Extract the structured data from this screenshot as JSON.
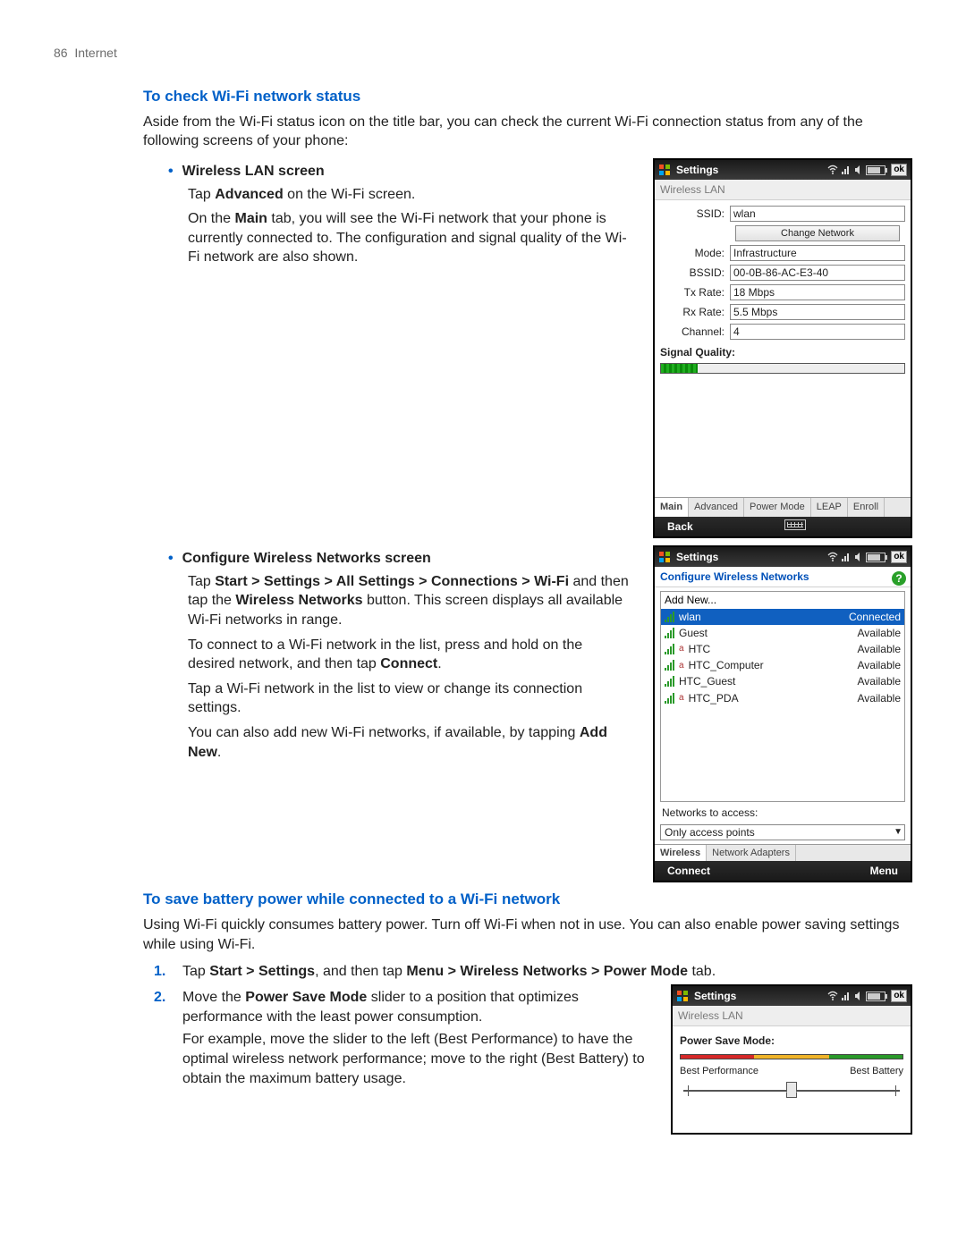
{
  "header": {
    "page_number": "86",
    "section": "Internet"
  },
  "s1": {
    "title": "To check Wi-Fi network status",
    "intro": "Aside from the Wi-Fi status icon on the title bar, you can check the current Wi-Fi connection status from any of the following screens of your phone:",
    "b1": {
      "head": "Wireless LAN screen",
      "p1a": "Tap ",
      "p1b": "Advanced",
      "p1c": " on the Wi-Fi screen.",
      "p2a": "On the ",
      "p2b": "Main",
      "p2c": " tab, you will see the Wi-Fi network that your phone is currently connected to. The configuration and signal quality of the Wi-Fi network are also shown."
    },
    "b2": {
      "head": "Configure Wireless Networks screen",
      "p1a": "Tap ",
      "p1b": "Start > Settings > All Settings > Connections > Wi-Fi",
      "p1c": " and then tap the ",
      "p1d": "Wireless Networks",
      "p1e": " button. This screen displays all available Wi-Fi networks in range.",
      "p2a": "To connect to a Wi-Fi network in the list, press and hold on the desired network, and then tap ",
      "p2b": "Connect",
      "p2c": ".",
      "p3": "Tap a Wi-Fi network in the list to view or change its connection settings.",
      "p4a": "You can also add new Wi-Fi networks, if available, by tapping ",
      "p4b": "Add New",
      "p4c": "."
    }
  },
  "s2": {
    "title": "To save battery power while connected to a Wi-Fi network",
    "intro": "Using Wi-Fi quickly consumes battery power. Turn off Wi-Fi when not in use. You can also enable power saving settings while using Wi-Fi.",
    "n1": {
      "num": "1.",
      "a": "Tap ",
      "b": "Start > Settings",
      "c": ", and then tap ",
      "d": "Menu > Wireless Networks > Power Mode",
      "e": " tab."
    },
    "n2": {
      "num": "2.",
      "a": "Move the ",
      "b": "Power Save Mode",
      "c": " slider to a position that optimizes performance with the least power consumption.",
      "p2": "For example, move the slider to the left (Best Performance) to have the optimal wireless network performance; move to the right (Best Battery) to obtain the maximum battery usage."
    }
  },
  "phone1": {
    "title": "Settings",
    "ok": "ok",
    "sub": "Wireless LAN",
    "rows": {
      "ssid_lbl": "SSID:",
      "ssid": "wlan",
      "change_btn": "Change Network",
      "mode_lbl": "Mode:",
      "mode": "Infrastructure",
      "bssid_lbl": "BSSID:",
      "bssid": "00-0B-86-AC-E3-40",
      "tx_lbl": "Tx Rate:",
      "tx": "18 Mbps",
      "rx_lbl": "Rx Rate:",
      "rx": "5.5 Mbps",
      "ch_lbl": "Channel:",
      "ch": "4"
    },
    "sig_label": "Signal Quality:",
    "sig_pct": 15,
    "tabs": [
      "Main",
      "Advanced",
      "Power Mode",
      "LEAP",
      "Enroll"
    ],
    "bottom_left": "Back"
  },
  "phone2": {
    "title": "Settings",
    "ok": "ok",
    "sub": "Configure Wireless Networks",
    "help": "?",
    "addnew": "Add New...",
    "networks": [
      {
        "name": "wlan",
        "status": "Connected",
        "selected": true,
        "secure": false
      },
      {
        "name": "Guest",
        "status": "Available",
        "selected": false,
        "secure": false
      },
      {
        "name": "HTC",
        "status": "Available",
        "selected": false,
        "secure": true
      },
      {
        "name": "HTC_Computer",
        "status": "Available",
        "selected": false,
        "secure": true
      },
      {
        "name": "HTC_Guest",
        "status": "Available",
        "selected": false,
        "secure": false
      },
      {
        "name": "HTC_PDA",
        "status": "Available",
        "selected": false,
        "secure": true
      }
    ],
    "ntx_label": "Networks to access:",
    "combo": "Only access points",
    "tabs": [
      "Wireless",
      "Network Adapters"
    ],
    "bottom_left": "Connect",
    "bottom_right": "Menu"
  },
  "phone3": {
    "title": "Settings",
    "ok": "ok",
    "sub": "Wireless LAN",
    "ps_title": "Power Save Mode:",
    "left_lbl": "Best Performance",
    "right_lbl": "Best Battery",
    "slider_pct": 50
  }
}
